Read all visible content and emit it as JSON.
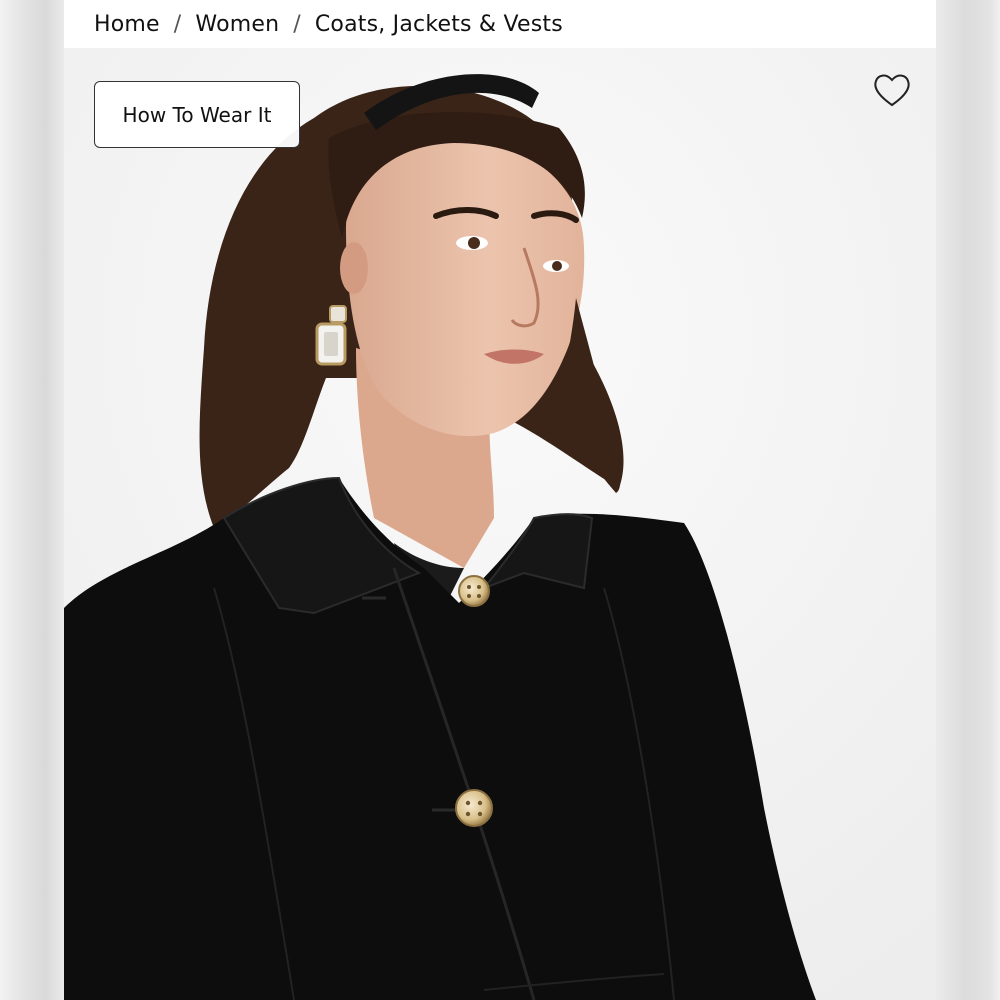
{
  "breadcrumb": {
    "items": [
      "Home",
      "Women",
      "Coats, Jackets & Vests"
    ],
    "separator": "/"
  },
  "product": {
    "how_to_wear_label": "How To Wear It",
    "favorite_icon": "heart-outline-icon",
    "image_alt": "Model wearing black wool coat with gold buttons"
  },
  "colors": {
    "coat": "#0d0d0d",
    "hair": "#3a2418",
    "background": "#f5f5f5",
    "button_gold": "#d9c08a"
  }
}
